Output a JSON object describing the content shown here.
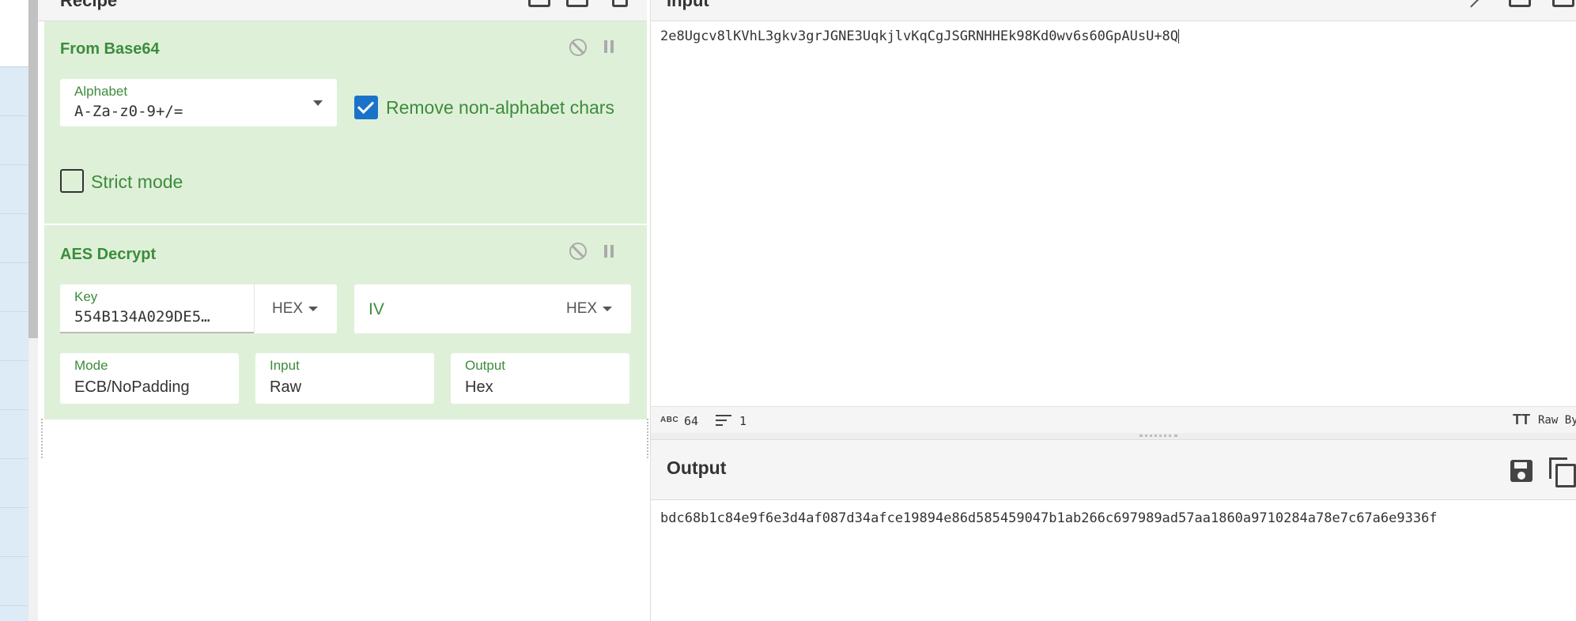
{
  "recipe": {
    "title": "Recipe",
    "operations": [
      {
        "title": "From Base64",
        "alphabet_label": "Alphabet",
        "alphabet_value": "A-Za-z0-9+/=",
        "remove_non_alpha_label": "Remove non-alphabet chars",
        "remove_non_alpha_checked": true,
        "strict_mode_label": "Strict mode",
        "strict_mode_checked": false
      },
      {
        "title": "AES Decrypt",
        "key_label": "Key",
        "key_value": "554B134A029DE5…",
        "key_format": "HEX",
        "iv_placeholder": "IV",
        "iv_format": "HEX",
        "mode_label": "Mode",
        "mode_value": "ECB/NoPadding",
        "input_label": "Input",
        "input_value": "Raw",
        "output_label": "Output",
        "output_value": "Hex"
      }
    ]
  },
  "input": {
    "title": "Input",
    "text": "2e8Ugcv8lKVhL3gkv3grJGNE3UqkjlvKqCgJSGRNHHEk98Kd0wv6s60GpAUsU+8Q",
    "status": {
      "char_badge": "ABC",
      "char_count": "64",
      "line_count": "1",
      "encoding_label": "Raw Bytes"
    }
  },
  "output": {
    "title": "Output",
    "text": "bdc68b1c84e9f6e3d4af087d34afce19894e86d585459047b1ab266c697989ad57aa1860a9710284a78e7c67a6e9336f"
  },
  "colors": {
    "op_background": "#dff0d8",
    "op_title": "#3c8c3c",
    "checkbox": "#1a73c8",
    "ops_list": "#dcebf6"
  }
}
